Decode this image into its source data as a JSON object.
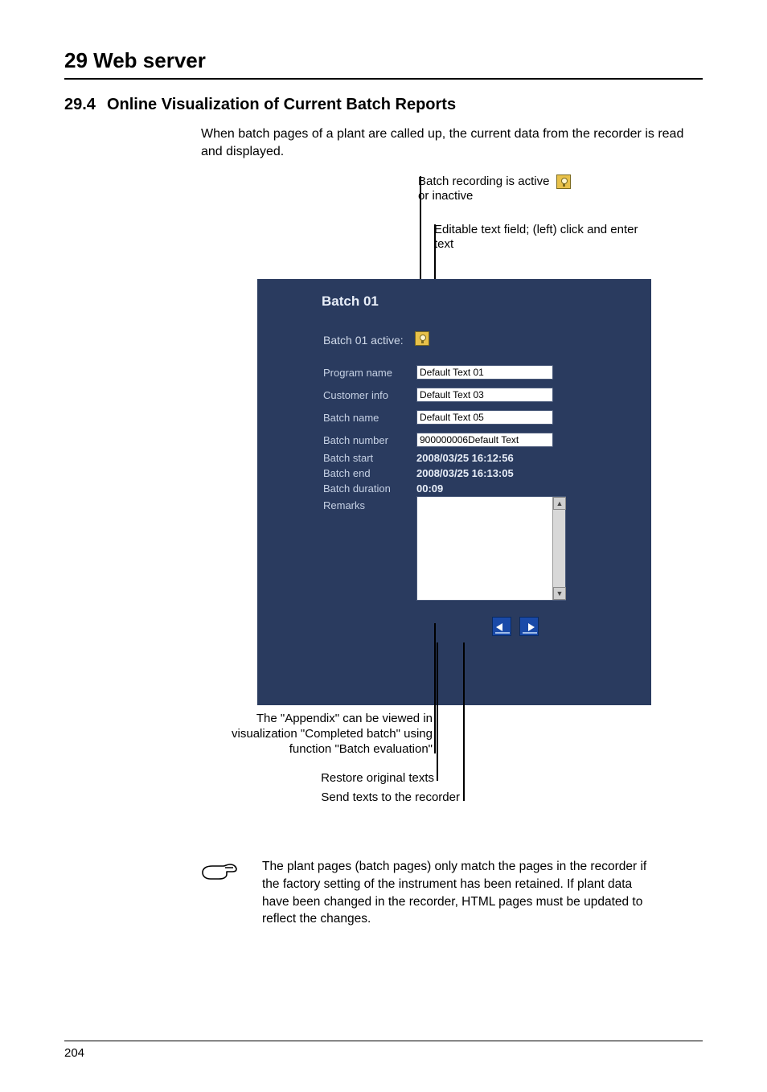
{
  "chapter": "29 Web server",
  "section_num": "29.4",
  "section_title": "Online Visualization of Current Batch Reports",
  "intro": "When batch pages of a plant are called up, the current data from the recorder is read and displayed.",
  "ann_top1_a": "Batch recording is active",
  "ann_top1_b": "or inactive",
  "ann_top2": "Editable text field; (left) click and enter text",
  "panel": {
    "title": "Batch 01",
    "active_label": "Batch 01 active:",
    "rows": {
      "program_name": {
        "label": "Program name",
        "value": "Default Text 01"
      },
      "customer_info": {
        "label": "Customer info",
        "value": "Default Text 03"
      },
      "batch_name": {
        "label": "Batch name",
        "value": "Default Text 05"
      },
      "batch_number": {
        "label": "Batch number",
        "value": "900000006Default Text"
      },
      "batch_start": {
        "label": "Batch start",
        "value": "2008/03/25 16:12:56"
      },
      "batch_end": {
        "label": "Batch end",
        "value": "2008/03/25 16:13:05"
      },
      "batch_duration": {
        "label": "Batch duration",
        "value": "00:09"
      },
      "remarks": {
        "label": "Remarks"
      }
    }
  },
  "ann_bot1": "The \"Appendix\" can be viewed in visualization \"Completed batch\" using function \"Batch evaluation\"",
  "ann_bot2": "Restore original texts",
  "ann_bot3": "Send texts to the recorder",
  "note": "The plant pages (batch pages) only match the pages in the recorder if the factory setting of the instrument has been retained. If plant data have been changed in the recorder, HTML pages must be updated to reflect the changes.",
  "page_number": "204"
}
